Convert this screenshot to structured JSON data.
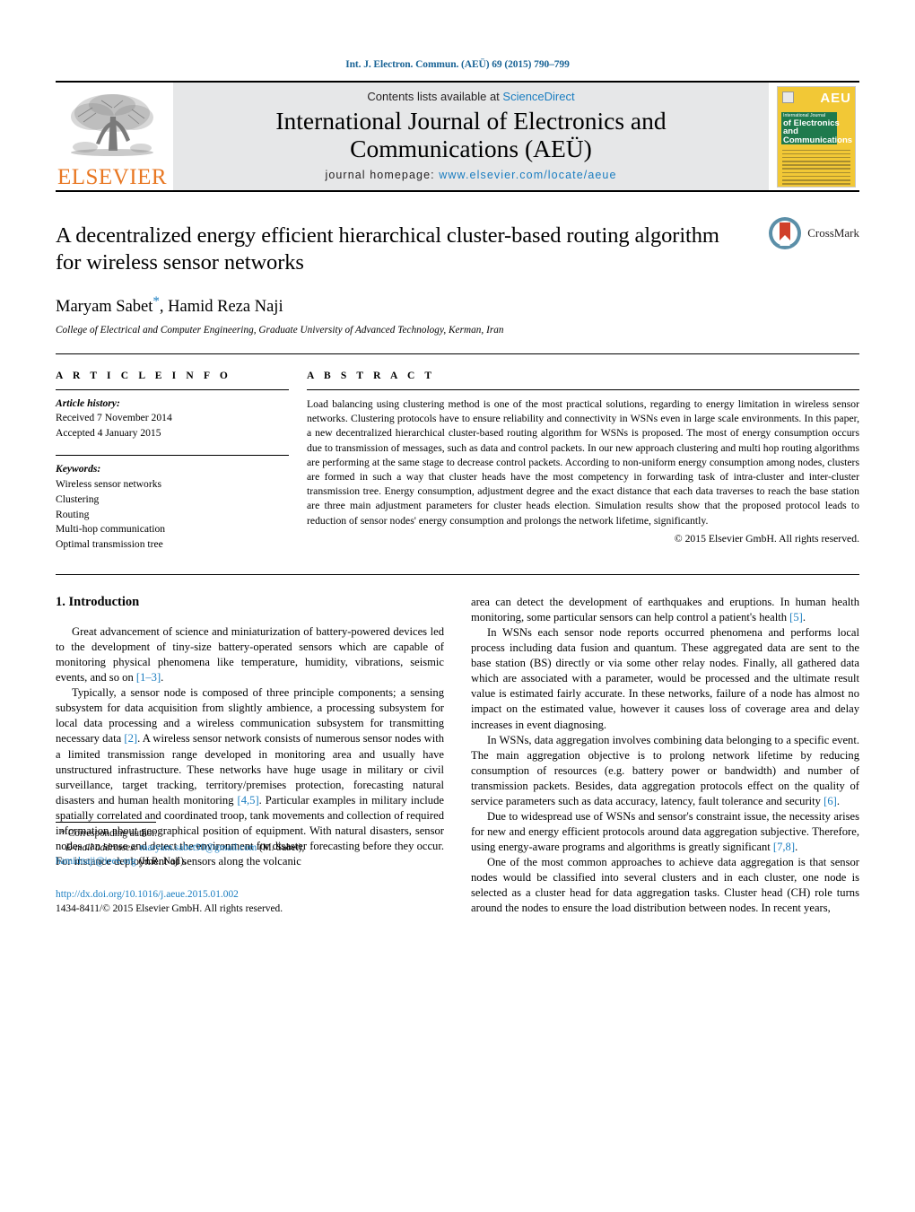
{
  "running_head": "Int. J. Electron. Commun. (AEÜ) 69 (2015) 790–799",
  "masthead": {
    "publisher_name": "ELSEVIER",
    "publisher_logo_icon": "elsevier-tree-icon",
    "contents_prefix": "Contents lists available at ",
    "contents_link": "ScienceDirect",
    "journal_title_line1": "International Journal of Electronics and",
    "journal_title_line2": "Communications (AEÜ)",
    "homepage_prefix": "journal homepage:",
    "homepage_url": "www.elsevier.com/locate/aeue",
    "cover": {
      "badge": "AEU",
      "line1": "International Journal",
      "line2": "of Electronics and",
      "line3": "Communications"
    }
  },
  "article": {
    "title": "A decentralized energy efficient hierarchical cluster-based routing algorithm for wireless sensor networks",
    "authors": "Maryam Sabet",
    "authors_rest": ", Hamid Reza Naji",
    "corresponding_marker": "*",
    "affiliation": "College of Electrical and Computer Engineering, Graduate University of Advanced Technology, Kerman, Iran",
    "crossmark_label": "CrossMark"
  },
  "article_info": {
    "heading": "A R T I C L E   I N F O",
    "history_label": "Article history:",
    "received": "Received 7 November 2014",
    "accepted": "Accepted 4 January 2015",
    "keywords_label": "Keywords:",
    "keywords": [
      "Wireless sensor networks",
      "Clustering",
      "Routing",
      "Multi-hop communication",
      "Optimal transmission tree"
    ]
  },
  "abstract": {
    "heading": "A B S T R A C T",
    "text": "Load balancing using clustering method is one of the most practical solutions, regarding to energy limitation in wireless sensor networks. Clustering protocols have to ensure reliability and connectivity in WSNs even in large scale environments. In this paper, a new decentralized hierarchical cluster-based routing algorithm for WSNs is proposed. The most of energy consumption occurs due to transmission of messages, such as data and control packets. In our new approach clustering and multi hop routing algorithms are performing at the same stage to decrease control packets. According to non-uniform energy consumption among nodes, clusters are formed in such a way that cluster heads have the most competency in forwarding task of intra-cluster and inter-cluster transmission tree. Energy consumption, adjustment degree and the exact distance that each data traverses to reach the base station are three main adjustment parameters for cluster heads election. Simulation results show that the proposed protocol leads to reduction of sensor nodes' energy consumption and prolongs the network lifetime, significantly.",
    "copyright": "© 2015 Elsevier GmbH. All rights reserved."
  },
  "body": {
    "section_heading": "1.  Introduction",
    "left_paragraphs": [
      "Great advancement of science and miniaturization of battery-powered devices led to the development of tiny-size battery-operated sensors which are capable of monitoring physical phenomena like temperature, humidity, vibrations, seismic events, and so on [1–3].",
      "Typically, a sensor node is composed of three principle components; a sensing subsystem for data acquisition from slightly ambience, a processing subsystem for local data processing and a wireless communication subsystem for transmitting necessary data [2]. A wireless sensor network consists of numerous sensor nodes with a limited transmission range developed in monitoring area and usually have unstructured infrastructure. These networks have huge usage in military or civil surveillance, target tracking, territory/premises protection, forecasting natural disasters and human health monitoring [4,5]. Particular examples in military include spatially correlated and coordinated troop, tank movements and collection of required information about geographical position of equipment. With natural disasters, sensor nodes can sense and detect the environment for disaster forecasting before they occur. For instance deployment of sensors along the volcanic"
    ],
    "right_paragraphs": [
      "area can detect the development of earthquakes and eruptions. In human health monitoring, some particular sensors can help control a patient's health [5].",
      "In WSNs each sensor node reports occurred phenomena and performs local process including data fusion and quantum. These aggregated data are sent to the base station (BS) directly or via some other relay nodes. Finally, all gathered data which are associated with a parameter, would be processed and the ultimate result value is estimated fairly accurate. In these networks, failure of a node has almost no impact on the estimated value, however it causes loss of coverage area and delay increases in event diagnosing.",
      "In WSNs, data aggregation involves combining data belonging to a specific event. The main aggregation objective is to prolong network lifetime by reducing consumption of resources (e.g. battery power or bandwidth) and number of transmission packets. Besides, data aggregation protocols effect on the quality of service parameters such as data accuracy, latency, fault tolerance and security [6].",
      "Due to widespread use of WSNs and sensor's constraint issue, the necessity arises for new and energy efficient protocols around data aggregation subjective. Therefore, using energy-aware programs and algorithms is greatly significant [7,8].",
      "One of the most common approaches to achieve data aggregation is that sensor nodes would be classified into several clusters and in each cluster, one node is selected as a cluster head for data aggregation tasks. Cluster head (CH) role turns around the nodes to ensure the load distribution between nodes. In recent years,"
    ]
  },
  "footnote": {
    "corresponding": "* Corresponding author.",
    "email_label": "E-mail addresses:",
    "email1": "maryam.sabet90@gmail.com",
    "email1_owner": "(M. Sabet),",
    "email2": "hamidnaji@ieee.org",
    "email2_owner": "(H.R. Naji).",
    "doi": "http://dx.doi.org/10.1016/j.aeue.2015.01.002",
    "issn_line": "1434-8411/© 2015 Elsevier GmbH. All rights reserved."
  },
  "colors": {
    "link_blue": "#1a7dc0",
    "elsevier_orange": "#e87722",
    "band_grey": "#e6e7e8",
    "crossmark_red": "#d0402a",
    "crossmark_blue": "#5b8fa8",
    "cover_yellow": "#f2c836",
    "cover_green": "#1f7a4d"
  }
}
